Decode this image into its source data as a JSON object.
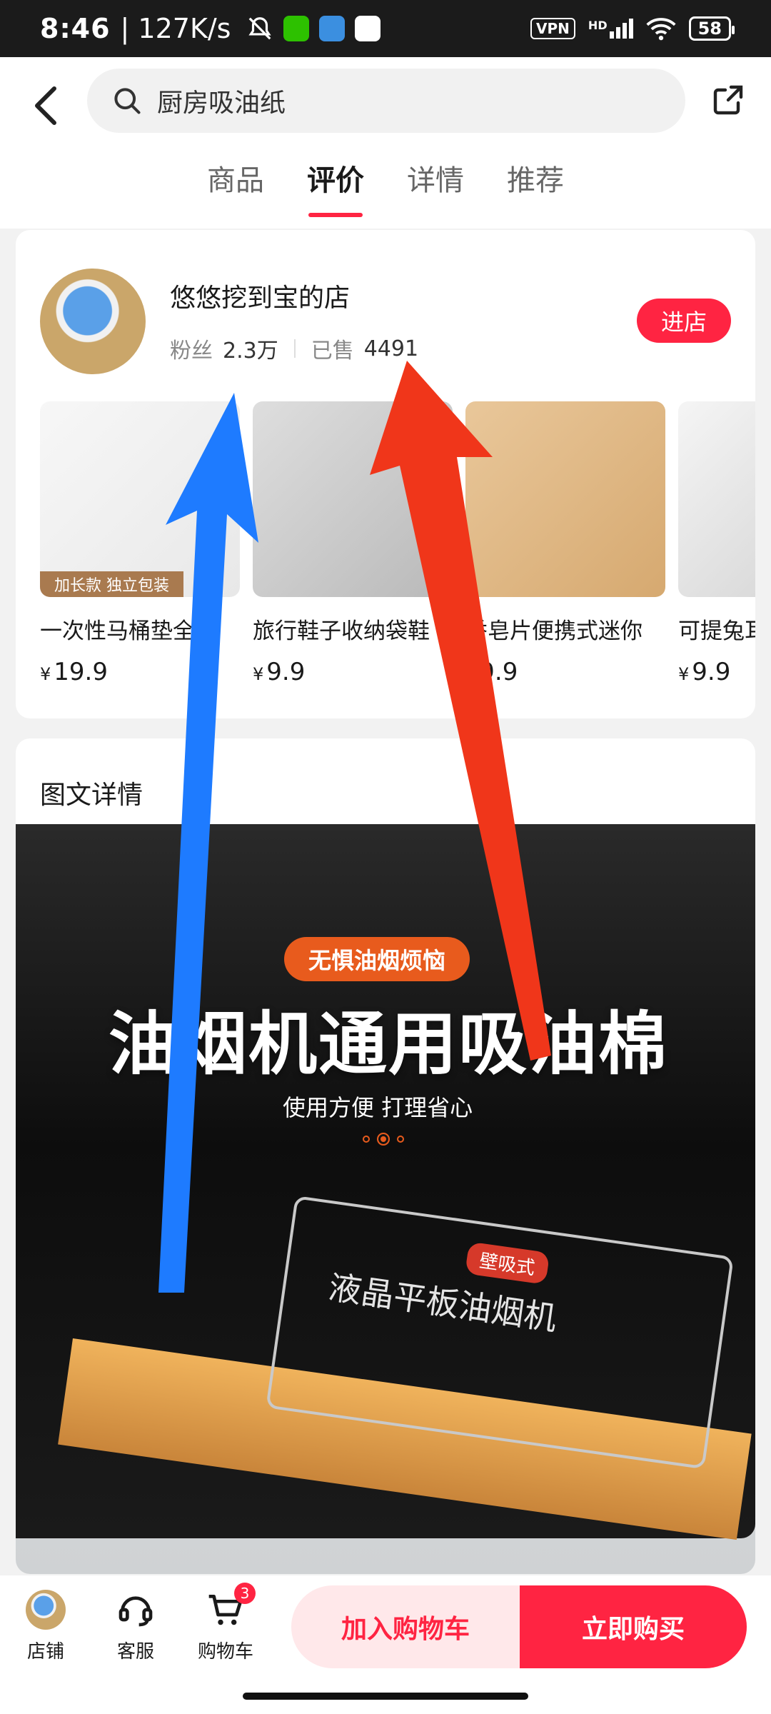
{
  "status_bar": {
    "time": "8:46",
    "speed": "| 127K/s",
    "vpn": "VPN",
    "network": "HD",
    "battery": "58"
  },
  "header": {
    "search_query": "厨房吸油纸",
    "tabs": [
      {
        "label": "商品"
      },
      {
        "label": "评价",
        "active": true
      },
      {
        "label": "详情"
      },
      {
        "label": "推荐"
      }
    ]
  },
  "shop": {
    "name": "悠悠挖到宝的店",
    "fans_label": "粉丝",
    "fans_value": "2.3万",
    "sold_label": "已售",
    "sold_value": "4491",
    "enter_label": "进店",
    "products": [
      {
        "title": "一次性马桶垫全",
        "currency": "¥",
        "price": "19.9",
        "ribbon": "加长款 独立包装"
      },
      {
        "title": "旅行鞋子收纳袋鞋",
        "currency": "¥",
        "price": "9.9"
      },
      {
        "title": "香皂片便携式迷你",
        "currency": "¥",
        "price": "9.9"
      },
      {
        "title": "可提兔耳",
        "currency": "¥",
        "price": "9.9"
      }
    ]
  },
  "detail": {
    "title": "图文详情",
    "banner": {
      "tag": "无惧油烟烦恼",
      "headline": "油烟机通用吸油棉",
      "subline": "使用方便 打理省心",
      "panel_tag": "壁吸式",
      "panel_text": "液晶平板油烟机"
    }
  },
  "bottom_bar": {
    "shop_label": "店铺",
    "service_label": "客服",
    "cart_label": "购物车",
    "cart_badge": "3",
    "add_to_cart": "加入购物车",
    "buy_now": "立即购买"
  },
  "colors": {
    "accent": "#ff2442",
    "arrow_blue": "#1e7bff",
    "arrow_red": "#f0361a"
  }
}
